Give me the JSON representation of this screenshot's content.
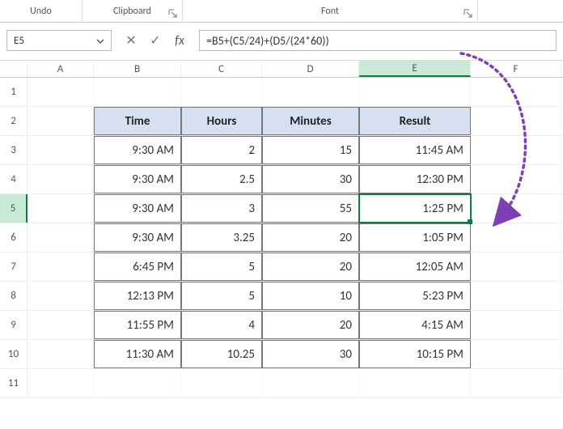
{
  "ribbon": {
    "undo": "Undo",
    "clipboard": "Clipboard",
    "font": "Font"
  },
  "namebox": "E5",
  "formula": "=B5+(C5/24)+(D5/(24*60))",
  "columns": [
    "A",
    "B",
    "C",
    "D",
    "E",
    "F"
  ],
  "row_numbers": [
    "1",
    "2",
    "3",
    "4",
    "5",
    "6",
    "7",
    "8",
    "9",
    "10",
    "11"
  ],
  "headers": {
    "b": "Time",
    "c": "Hours",
    "d": "Minutes",
    "e": "Result"
  },
  "data": [
    {
      "b": "9:30 AM",
      "c": "2",
      "d": "15",
      "e": "11:45 AM"
    },
    {
      "b": "9:30 AM",
      "c": "2.5",
      "d": "30",
      "e": "12:30 PM"
    },
    {
      "b": "9:30 AM",
      "c": "3",
      "d": "55",
      "e": "1:25 PM"
    },
    {
      "b": "9:30 AM",
      "c": "3.25",
      "d": "20",
      "e": "1:05 PM"
    },
    {
      "b": "6:45 PM",
      "c": "5",
      "d": "20",
      "e": "12:05 AM"
    },
    {
      "b": "12:13 PM",
      "c": "5",
      "d": "10",
      "e": "5:23 PM"
    },
    {
      "b": "11:55 PM",
      "c": "4",
      "d": "20",
      "e": "4:15 AM"
    },
    {
      "b": "11:30 AM",
      "c": "10.25",
      "d": "30",
      "e": "10:15 PM"
    }
  ],
  "arrow_color": "#7e3fb5"
}
